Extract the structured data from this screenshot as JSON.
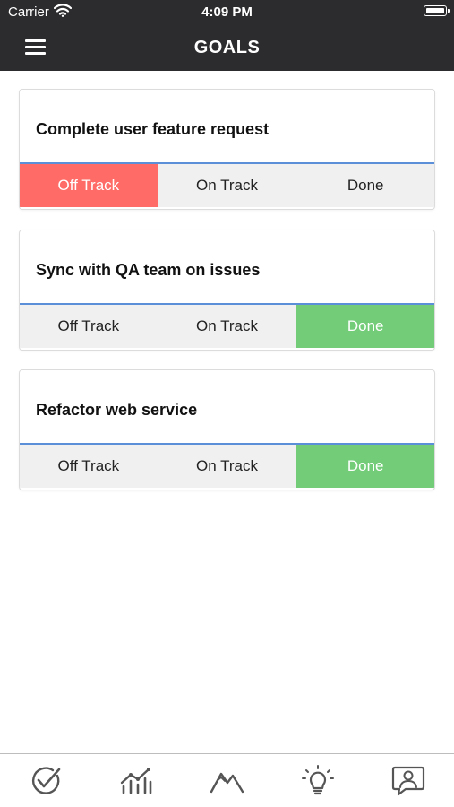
{
  "status": {
    "carrier": "Carrier",
    "time": "4:09 PM"
  },
  "nav": {
    "title": "GOALS"
  },
  "goals": [
    {
      "title": "Complete user feature request",
      "options": [
        "Off Track",
        "On Track",
        "Done"
      ],
      "selected": "Off Track"
    },
    {
      "title": "Sync with QA team on issues",
      "options": [
        "Off Track",
        "On Track",
        "Done"
      ],
      "selected": "Done"
    },
    {
      "title": "Refactor web service",
      "options": [
        "Off Track",
        "On Track",
        "Done"
      ],
      "selected": "Done"
    }
  ],
  "tabs": [
    {
      "icon": "goals-check-icon"
    },
    {
      "icon": "metrics-chart-icon"
    },
    {
      "icon": "mountain-icon"
    },
    {
      "icon": "lightbulb-icon"
    },
    {
      "icon": "feedback-person-icon"
    }
  ],
  "colors": {
    "bar": "#2c2c2e",
    "off_track": "#ff6b66",
    "done": "#72cc78",
    "divider": "#5b8fd8"
  }
}
